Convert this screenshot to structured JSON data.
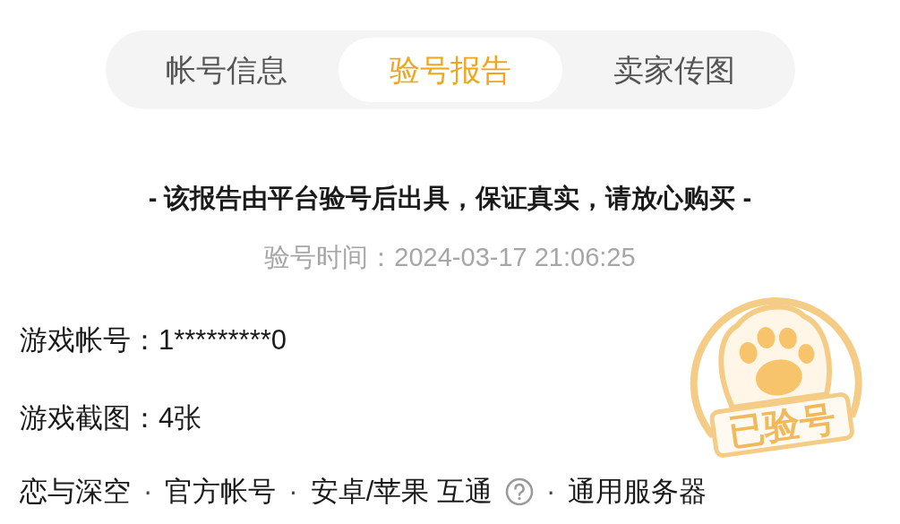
{
  "tabs": [
    {
      "label": "帐号信息",
      "selected": false
    },
    {
      "label": "验号报告",
      "selected": true
    },
    {
      "label": "卖家传图",
      "selected": false
    }
  ],
  "report": {
    "notice": "- 该报告由平台验号后出具，保证真实，请放心购买 -",
    "time_label": "验号时间：",
    "time": "2024-03-17 21:06:25"
  },
  "fields": [
    {
      "label": "游戏帐号：",
      "value": "1*********0"
    },
    {
      "label": "游戏截图：",
      "value": "4张"
    }
  ],
  "tags": [
    {
      "text": "恋与深空",
      "help": false
    },
    {
      "text": "官方帐号",
      "help": false
    },
    {
      "text": "安卓/苹果 互通",
      "help": true
    },
    {
      "text": "通用服务器",
      "help": false
    }
  ],
  "separator": "·",
  "stamp": {
    "label": "已验号"
  }
}
